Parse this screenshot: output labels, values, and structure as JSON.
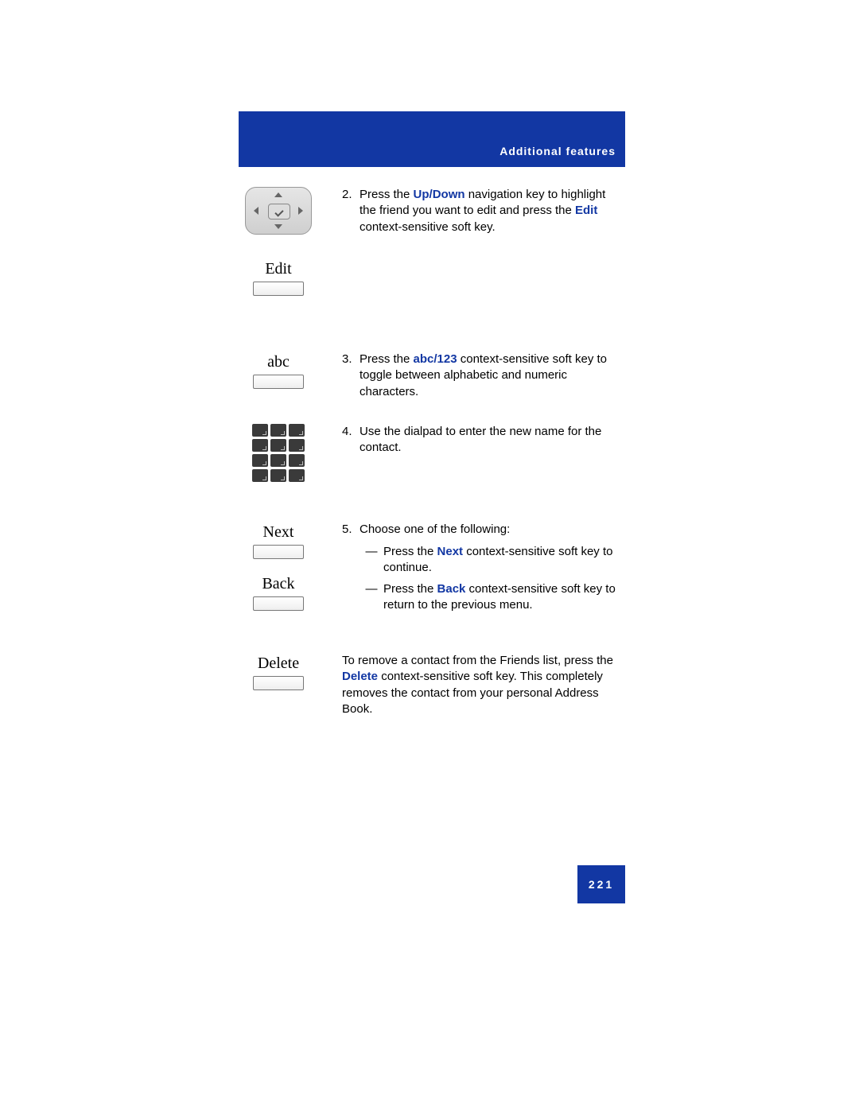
{
  "header": {
    "title": "Additional features"
  },
  "softkeys": {
    "edit": "Edit",
    "abc": "abc",
    "next": "Next",
    "back": "Back",
    "delete": "Delete"
  },
  "steps": {
    "s2": {
      "num": "2.",
      "pre": "Press the ",
      "k1": "Up/Down",
      "mid": " navigation key to highlight the friend you want to edit and press the ",
      "k2": "Edit",
      "post": " context-sensitive soft key."
    },
    "s3": {
      "num": "3.",
      "pre": "Press the ",
      "k1": "abc/123",
      "post": " context-sensitive soft key to toggle between alphabetic and numeric characters."
    },
    "s4": {
      "num": "4.",
      "text": "Use the dialpad to enter the new name for the contact."
    },
    "s5": {
      "num": "5.",
      "lead": "Choose one of the following:",
      "opt1": {
        "pre": "Press the ",
        "k": "Next",
        "post": " context-sensitive soft key to continue."
      },
      "opt2": {
        "pre": "Press the ",
        "k": "Back",
        "post": " context-sensitive soft key to return to the previous menu."
      }
    },
    "del": {
      "pre": "To remove a contact from the Friends list, press the ",
      "k": "Delete",
      "post": " context-sensitive soft key. This completely removes the contact from your personal Address Book."
    }
  },
  "dash": "—",
  "page_number": "221"
}
